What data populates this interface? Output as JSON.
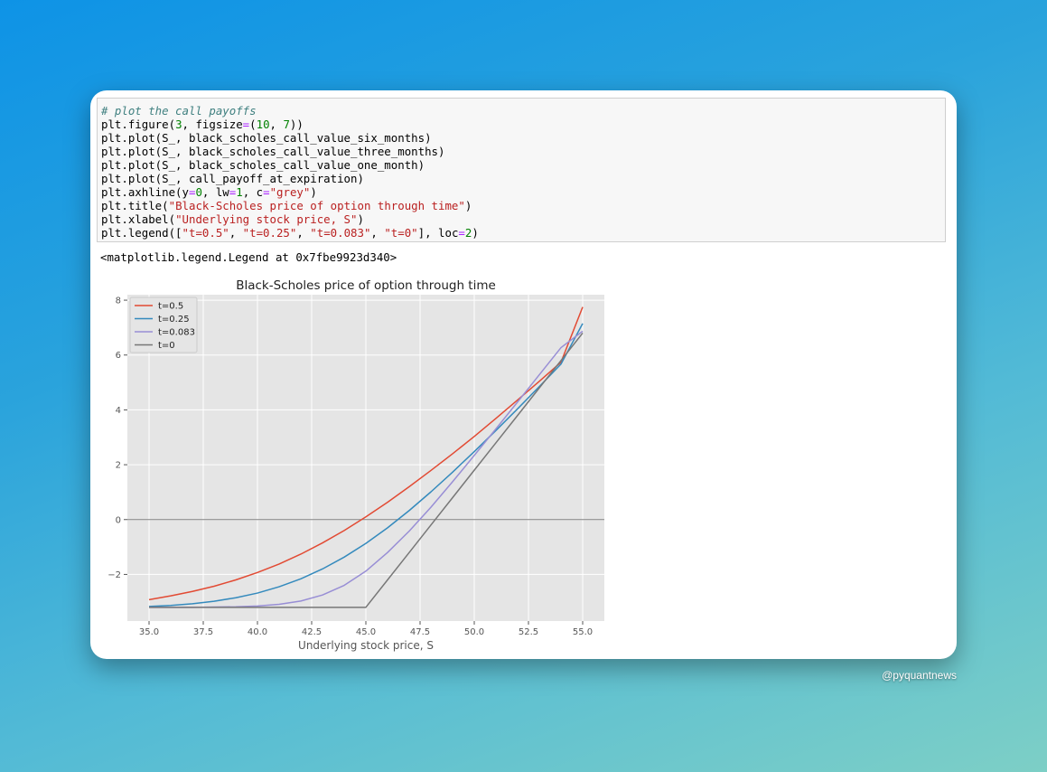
{
  "code_cell": {
    "lines": [
      [
        {
          "t": "# plot the call payoffs",
          "c": "c"
        }
      ],
      [
        {
          "t": "plt.figure("
        },
        {
          "t": "3",
          "c": "n"
        },
        {
          "t": ", figsize"
        },
        {
          "t": "=",
          "c": "o"
        },
        {
          "t": "("
        },
        {
          "t": "10",
          "c": "n"
        },
        {
          "t": ", "
        },
        {
          "t": "7",
          "c": "n"
        },
        {
          "t": "))"
        }
      ],
      [
        {
          "t": "plt.plot(S_, black_scholes_call_value_six_months)"
        }
      ],
      [
        {
          "t": "plt.plot(S_, black_scholes_call_value_three_months)"
        }
      ],
      [
        {
          "t": "plt.plot(S_, black_scholes_call_value_one_month)"
        }
      ],
      [
        {
          "t": "plt.plot(S_, call_payoff_at_expiration)"
        }
      ],
      [
        {
          "t": "plt.axhline(y"
        },
        {
          "t": "=",
          "c": "o"
        },
        {
          "t": "0",
          "c": "n"
        },
        {
          "t": ", lw"
        },
        {
          "t": "=",
          "c": "o"
        },
        {
          "t": "1",
          "c": "n"
        },
        {
          "t": ", c"
        },
        {
          "t": "=",
          "c": "o"
        },
        {
          "t": "\"grey\"",
          "c": "s"
        },
        {
          "t": ")"
        }
      ],
      [
        {
          "t": "plt.title("
        },
        {
          "t": "\"Black-Scholes price of option through time\"",
          "c": "s"
        },
        {
          "t": ")"
        }
      ],
      [
        {
          "t": "plt.xlabel("
        },
        {
          "t": "\"Underlying stock price, S\"",
          "c": "s"
        },
        {
          "t": ")"
        }
      ],
      [
        {
          "t": "plt.legend(["
        },
        {
          "t": "\"t=0.5\"",
          "c": "s"
        },
        {
          "t": ", "
        },
        {
          "t": "\"t=0.25\"",
          "c": "s"
        },
        {
          "t": ", "
        },
        {
          "t": "\"t=0.083\"",
          "c": "s"
        },
        {
          "t": ", "
        },
        {
          "t": "\"t=0\"",
          "c": "s"
        },
        {
          "t": "], loc"
        },
        {
          "t": "=",
          "c": "o"
        },
        {
          "t": "2",
          "c": "n"
        },
        {
          "t": ")"
        }
      ]
    ]
  },
  "output": {
    "text": "<matplotlib.legend.Legend at 0x7fbe9923d340>"
  },
  "watermark": "@pyquantnews",
  "chart_data": {
    "type": "line",
    "title": "Black-Scholes price of option through time",
    "xlabel": "Underlying stock price, S",
    "ylabel": "",
    "xlim": [
      34.0,
      56.0
    ],
    "ylim": [
      -3.7,
      8.2
    ],
    "xticks": [
      35.0,
      37.5,
      40.0,
      42.5,
      45.0,
      47.5,
      50.0,
      52.5,
      55.0
    ],
    "xtick_labels": [
      "35.0",
      "37.5",
      "40.0",
      "42.5",
      "45.0",
      "47.5",
      "50.0",
      "52.5",
      "55.0"
    ],
    "yticks": [
      -2,
      0,
      2,
      4,
      6,
      8
    ],
    "ytick_labels": [
      "−2",
      "0",
      "2",
      "4",
      "6",
      "8"
    ],
    "grid": true,
    "legend_position": "top-left",
    "axhline": {
      "y": 0,
      "color": "#808080"
    },
    "x": [
      35.0,
      36.0,
      37.0,
      38.0,
      39.0,
      40.0,
      41.0,
      42.0,
      43.0,
      44.0,
      45.0,
      46.0,
      47.0,
      48.0,
      49.0,
      50.0,
      51.0,
      52.0,
      53.0,
      54.0,
      55.0
    ],
    "series": [
      {
        "name": "t=0.5",
        "color": "#e24a33",
        "values": [
          -2.92,
          -2.78,
          -2.62,
          -2.43,
          -2.2,
          -1.93,
          -1.62,
          -1.26,
          -0.85,
          -0.4,
          0.1,
          0.63,
          1.2,
          1.79,
          2.4,
          3.03,
          3.69,
          4.36,
          5.04,
          5.74,
          7.75
        ]
      },
      {
        "name": "t=0.25",
        "color": "#348abd",
        "values": [
          -3.17,
          -3.13,
          -3.07,
          -2.98,
          -2.85,
          -2.68,
          -2.45,
          -2.16,
          -1.8,
          -1.37,
          -0.87,
          -0.3,
          0.33,
          1.01,
          1.73,
          2.48,
          3.25,
          4.04,
          4.85,
          5.67,
          7.15
        ]
      },
      {
        "name": "t=0.083",
        "color": "#988ed5",
        "values": [
          -3.2,
          -3.2,
          -3.2,
          -3.19,
          -3.18,
          -3.15,
          -3.09,
          -2.97,
          -2.75,
          -2.4,
          -1.88,
          -1.2,
          -0.42,
          0.45,
          1.38,
          2.34,
          3.31,
          4.29,
          5.28,
          6.27,
          6.87
        ]
      },
      {
        "name": "t=0",
        "color": "#777777",
        "values": [
          -3.2,
          -3.2,
          -3.2,
          -3.2,
          -3.2,
          -3.2,
          -3.2,
          -3.2,
          -3.2,
          -3.2,
          -3.2,
          -2.2,
          -1.2,
          -0.2,
          0.8,
          1.8,
          2.8,
          3.8,
          4.8,
          5.8,
          6.8
        ]
      }
    ]
  }
}
